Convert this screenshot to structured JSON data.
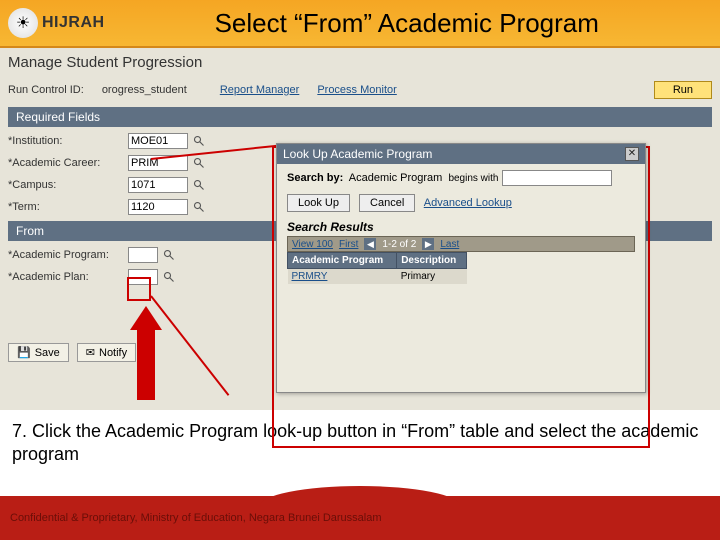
{
  "brand": {
    "name": "HIJRAH"
  },
  "slide_title": "Select “From” Academic Program",
  "page_title": "Manage Student Progression",
  "run_control": {
    "label": "Run Control ID:",
    "value": "orogress_student",
    "report_manager": "Report Manager",
    "process_monitor": "Process Monitor",
    "run_label": "Run"
  },
  "sections": {
    "required": "Required Fields",
    "from": "From"
  },
  "fields": {
    "institution": {
      "label": "*Institution:",
      "value": "MOE01"
    },
    "career": {
      "label": "*Academic Career:",
      "value": "PRIM"
    },
    "campus": {
      "label": "*Campus:",
      "value": "1071"
    },
    "term": {
      "label": "*Term:",
      "value": "1120"
    },
    "program": {
      "label": "*Academic Program:",
      "value": ""
    },
    "plan": {
      "label": "*Academic Plan:",
      "value": ""
    }
  },
  "action_buttons": {
    "save": "Save",
    "notify": "Notify"
  },
  "popup": {
    "title": "Look Up Academic Program",
    "search_by_label": "Search by:",
    "search_by_field": "Academic Program",
    "operator": "begins with",
    "search_value": "",
    "lookup_btn": "Look Up",
    "cancel_btn": "Cancel",
    "advanced": "Advanced Lookup",
    "results_heading": "Search Results",
    "nav": {
      "view100": "View 100",
      "first": "First",
      "range": "1-2 of 2",
      "last": "Last"
    },
    "columns": {
      "prog": "Academic Program",
      "desc": "Description"
    },
    "rows": [
      {
        "prog": "PRMRY",
        "desc": "Primary"
      }
    ]
  },
  "instruction": "7. Click the Academic Program look-up button in “From” table and select the academic program",
  "footer_text": "Confidential & Proprietary, Ministry of Education, Negara Brunei Darussalam"
}
